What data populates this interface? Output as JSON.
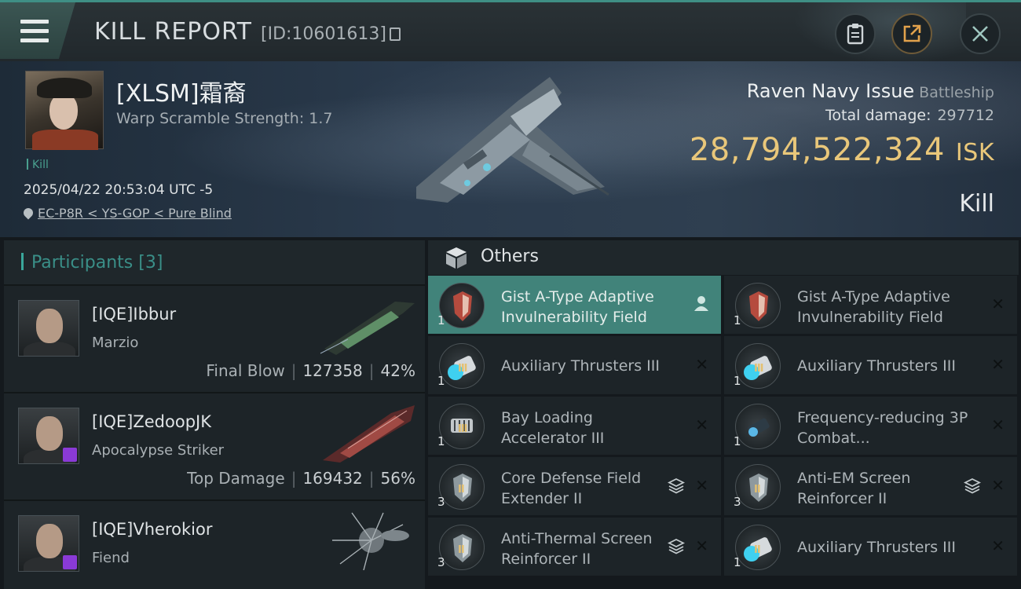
{
  "header": {
    "title": "KILL REPORT",
    "kill_id": "[ID:10601613]"
  },
  "victim": {
    "name": "[XLSM]霜裔",
    "warp_scramble": "Warp Scramble Strength: 1.7",
    "tag": "Kill",
    "datetime": "2025/04/22 20:53:04 UTC -5",
    "location": "EC-P8R < YS-GOP < Pure Blind",
    "ship": "Raven Navy Issue",
    "ship_class": "Battleship",
    "total_damage_label": "Total damage:",
    "total_damage": "297712",
    "isk_value": "28,794,522,324",
    "isk_unit": "ISK",
    "result": "Kill"
  },
  "participants": {
    "label": "Participants",
    "count": "[3]",
    "rows": [
      {
        "name": "[IQE]Ibbur",
        "ship": "Marzio",
        "role": "Final Blow",
        "damage": "127358",
        "percent": "42%"
      },
      {
        "name": "[IQE]ZedoopJK",
        "ship": "Apocalypse Striker",
        "role": "Top Damage",
        "damage": "169432",
        "percent": "56%"
      },
      {
        "name": "[IQE]Vherokior",
        "ship": "Fiend"
      }
    ]
  },
  "items": {
    "label": "Others",
    "left": [
      {
        "name": "Gist A-Type Adaptive Invulnerability Field",
        "qty": "1"
      },
      {
        "name": "Auxiliary Thrusters III",
        "qty": "1"
      },
      {
        "name": "Bay Loading Accelerator III",
        "qty": "1"
      },
      {
        "name": "Core Defense Field Extender II",
        "qty": "3"
      },
      {
        "name": "Anti-Thermal Screen Reinforcer II",
        "qty": "3"
      }
    ],
    "right": [
      {
        "name": "Gist A-Type Adaptive Invulnerability Field",
        "qty": "1"
      },
      {
        "name": "Auxiliary Thrusters III",
        "qty": "1"
      },
      {
        "name": "Frequency-reducing 3P Combat...",
        "qty": "1"
      },
      {
        "name": "Anti-EM Screen Reinforcer II",
        "qty": "3"
      },
      {
        "name": "Auxiliary Thrusters III",
        "qty": "1"
      }
    ]
  },
  "colors": {
    "accent": "#41837a",
    "isk": "#e9c77a",
    "header_accent": "#3f8f85"
  }
}
